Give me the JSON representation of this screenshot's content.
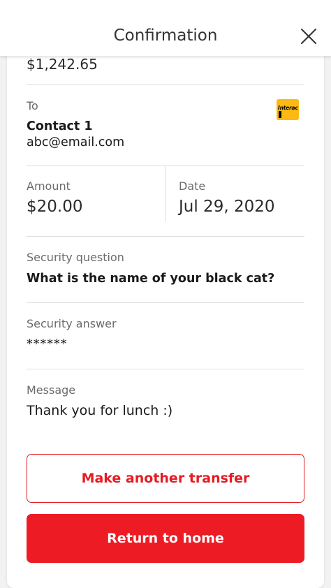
{
  "header": {
    "title": "Confirmation",
    "close_icon": "close-icon"
  },
  "balance": {
    "value": "$1,242.65"
  },
  "recipient": {
    "label": "To",
    "name": "Contact 1",
    "email": "abc@email.com",
    "logo_icon": "interac-logo-icon",
    "logo_text": "Interac"
  },
  "amount": {
    "label": "Amount",
    "value": "$20.00"
  },
  "date": {
    "label": "Date",
    "value": "Jul 29, 2020"
  },
  "security_question": {
    "label": "Security question",
    "value": "What is the name of your black cat?"
  },
  "security_answer": {
    "label": "Security answer",
    "value": "******"
  },
  "message": {
    "label": "Message",
    "value": "Thank you for lunch :)"
  },
  "actions": {
    "make_another_label": "Make another transfer",
    "return_home_label": "Return to home"
  },
  "colors": {
    "brand_red": "#ed1c24",
    "interac_yellow": "#fdb913",
    "label_gray": "#6b6b6b",
    "divider_gray": "#dedede"
  }
}
